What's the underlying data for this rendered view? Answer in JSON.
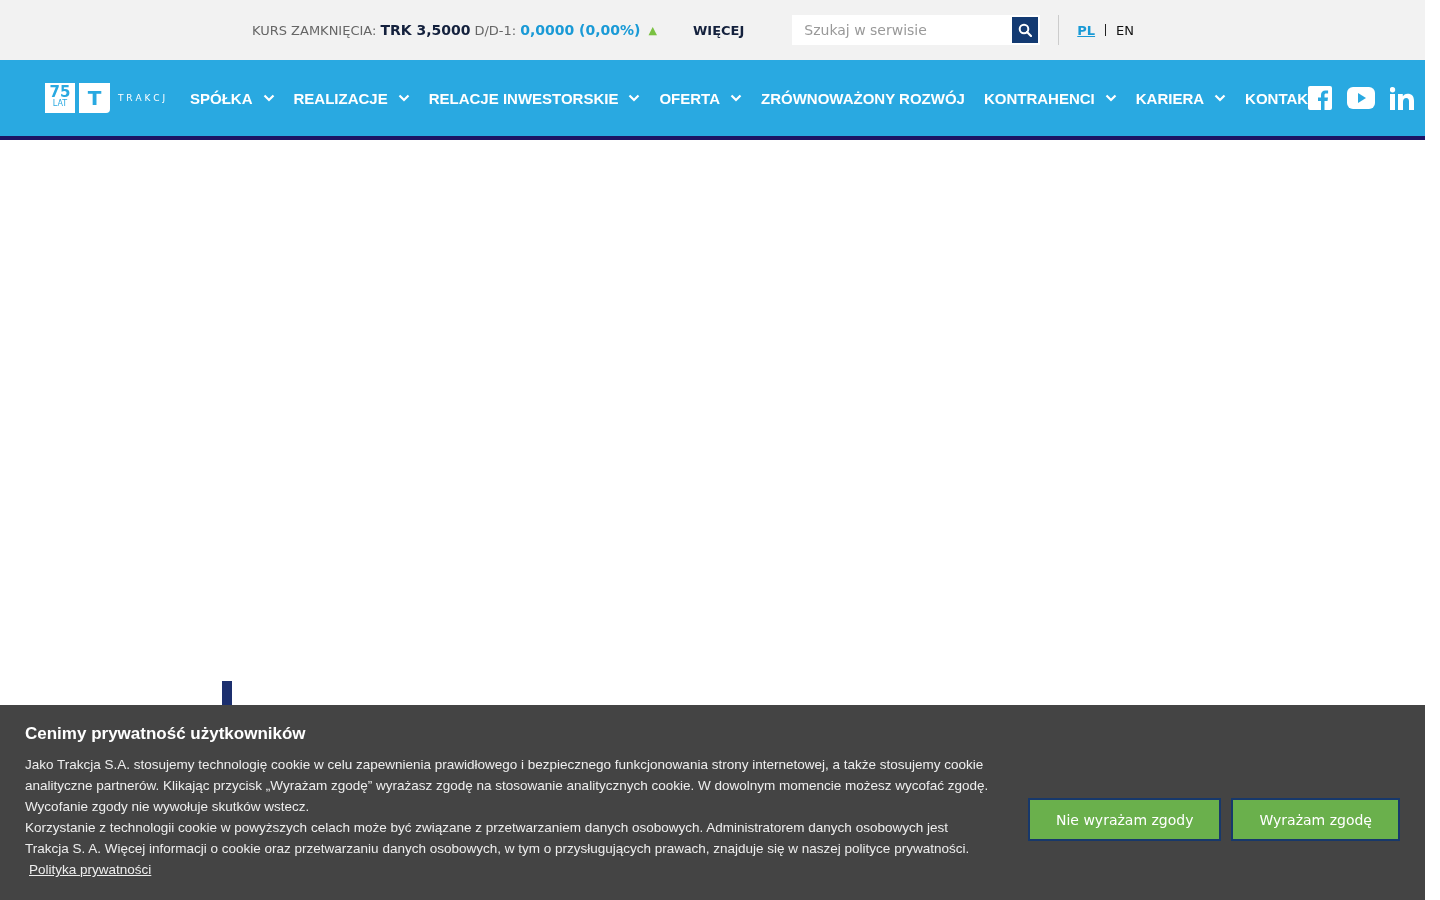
{
  "top_bar": {
    "quote_label": "KURS ZAMKNIĘCIA:",
    "quote_value": "TRK 3,5000",
    "change_label": "D/D-1:",
    "change_value": "0,0000 (0,00%)",
    "trend_icon": "▲",
    "more_link": "WIĘCEJ",
    "search": {
      "placeholder": "Szukaj w serwisie"
    },
    "languages": [
      {
        "label": "PL",
        "selected": true
      },
      {
        "label": "EN",
        "selected": false
      }
    ]
  },
  "logo": {
    "badge_number": "75",
    "badge_text": "LAT",
    "letter": "T",
    "wordmark": "T R A K C J"
  },
  "nav": [
    {
      "label": "SPÓŁKA",
      "dropdown": true
    },
    {
      "label": "REALIZACJE",
      "dropdown": true
    },
    {
      "label": "RELACJE INWESTORSKIE",
      "dropdown": true
    },
    {
      "label": "OFERTA",
      "dropdown": true
    },
    {
      "label": "ZRÓWNOWAŻONY ROZWÓJ",
      "dropdown": false
    },
    {
      "label": "KONTRAHENCI",
      "dropdown": true
    },
    {
      "label": "KARIERA",
      "dropdown": true
    },
    {
      "label": "KONTAK",
      "dropdown": false
    }
  ],
  "social": [
    {
      "kind": "facebook"
    },
    {
      "kind": "youtube"
    },
    {
      "kind": "linkedin"
    }
  ],
  "cookie_banner": {
    "title": "Cenimy prywatność użytkowników",
    "paragraphs": [
      "Jako Trakcja S.A. stosujemy technologię cookie w celu zapewnienia prawidłowego i bezpiecznego funkcjonowania strony internetowej, a także stosujemy cookie analityczne partnerów. Klikając przycisk „Wyrażam zgodę” wyrażasz zgodę na stosowanie analitycznych cookie. W dowolnym momencie możesz wycofać zgodę. Wycofanie zgody nie wywołuje skutków wstecz.",
      "Korzystanie z technologii cookie w powyższych celach może być związane z przetwarzaniem danych osobowych. Administratorem danych osobowych jest Trakcja S. A. Więcej informacji o cookie oraz przetwarzaniu danych osobowych, w tym o przysługujących prawach, znajduje się w naszej polityce prywatności."
    ],
    "policy_link": "Polityka prywatności",
    "buttons": [
      "Nie wyrażam zgody",
      "Wyrażam zgodę"
    ]
  }
}
